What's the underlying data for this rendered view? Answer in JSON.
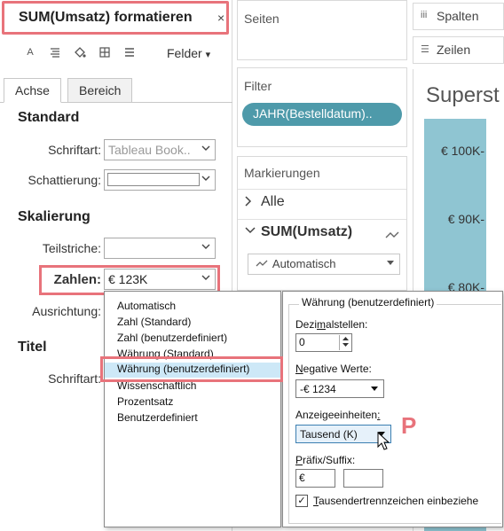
{
  "format_pane": {
    "title": "SUM(Umsatz) formatieren",
    "close_glyph": "×",
    "toolbar": {
      "icons": [
        "font-icon",
        "align-icon",
        "shading-icon",
        "borders-icon",
        "lines-icon"
      ],
      "font_glyph": "A",
      "felder_label": "Felder",
      "felder_chevron": "▾"
    },
    "tabs": [
      {
        "label": "Achse",
        "active": true
      },
      {
        "label": "Bereich",
        "active": false
      }
    ],
    "standard": {
      "heading": "Standard",
      "font_label": "Schriftart:",
      "font_value": "Tableau Book..",
      "shading_label": "Schattierung:"
    },
    "scaling": {
      "heading": "Skalierung",
      "ticks_label": "Teilstriche:",
      "numbers_label": "Zahlen:",
      "numbers_value": "€ 123K",
      "alignment_label": "Ausrichtung:"
    },
    "title_section": {
      "heading": "Titel",
      "font_label": "Schriftart:"
    }
  },
  "shelves": {
    "pages": "Seiten",
    "filter": "Filter",
    "filter_pill": "JAHR(Bestelldatum)..",
    "marks": {
      "title": "Markierungen",
      "all_label": "Alle",
      "sum_label": "SUM(Umsatz)",
      "mark_type": "Automatisch"
    },
    "columns": "Spalten",
    "rows": "Zeilen",
    "columns_icon": "iii",
    "rows_icon": "☰"
  },
  "viz": {
    "title": "Superst",
    "ticks": [
      "€ 100K-",
      "€ 90K-",
      "€ 80K-"
    ],
    "bar_color": "#8fc5d2"
  },
  "number_formats": {
    "options": [
      "Automatisch",
      "Zahl (Standard)",
      "Zahl (benutzerdefiniert)",
      "Währung (Standard)",
      "Währung (benutzerdefiniert)",
      "Wissenschaftlich",
      "Prozentsatz",
      "Benutzerdefiniert"
    ],
    "selected_index": 4
  },
  "currency_panel": {
    "group_title": "Währung (benutzerdefiniert)",
    "decimals_label_pre": "Dezi",
    "decimals_label_u": "m",
    "decimals_label_post": "alstellen:",
    "decimals_value": "0",
    "negative_label_u": "N",
    "negative_label_post": "egative Werte:",
    "negative_value": "-€ 1234",
    "units_label_pre": "Anzeigeeinheiten",
    "units_label_u": ":",
    "units_value": "Tausend (K)",
    "prefix_label_pre": "P",
    "prefix_label_post": "räfix/Suffix:",
    "prefix_value": "€",
    "suffix_value": "",
    "thousands_label_u": "T",
    "thousands_label_post": "ausendertrennzeichen einbeziehe",
    "thousands_checked": true,
    "check_glyph": "✓"
  },
  "annotation_letter": "P",
  "accent_color": "#e8737b"
}
